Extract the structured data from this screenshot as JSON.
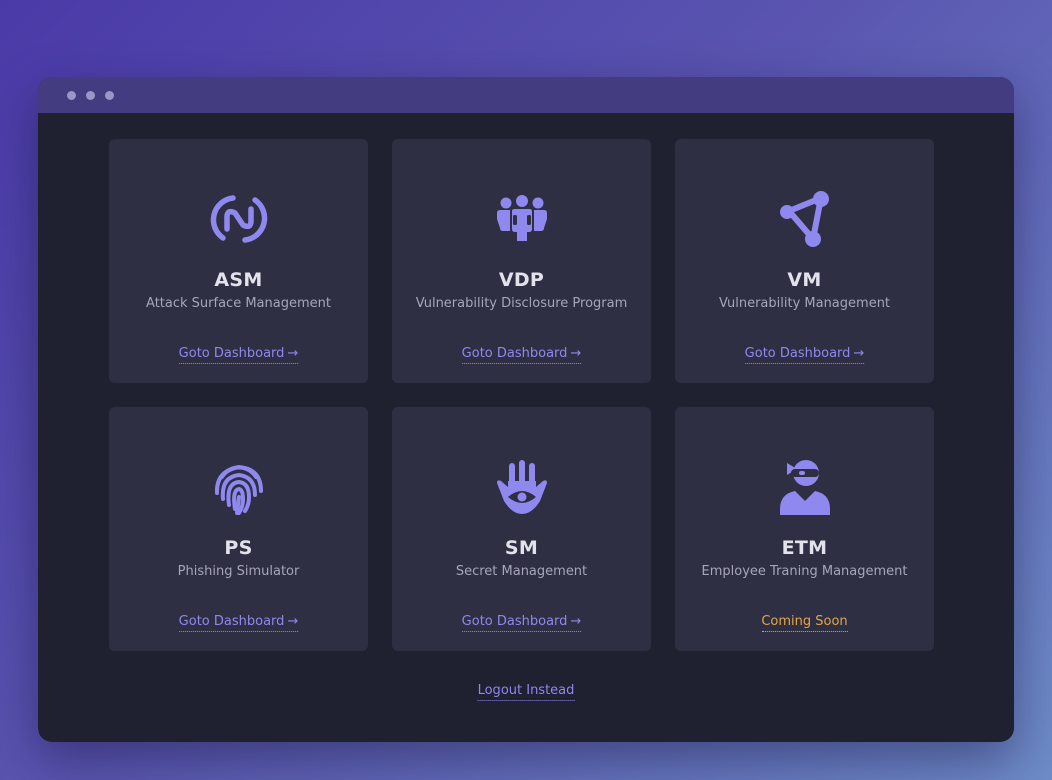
{
  "accent_color": "#8f88ee",
  "soon_color": "#e3a54a",
  "cards": [
    {
      "code": "ASM",
      "name": "Attack Surface Management",
      "action": "Goto Dashboard",
      "arrow": "→",
      "icon": "nfc-link-icon"
    },
    {
      "code": "VDP",
      "name": "Vulnerability Disclosure Program",
      "action": "Goto Dashboard",
      "arrow": "→",
      "icon": "people-group-icon"
    },
    {
      "code": "VM",
      "name": "Vulnerability Management",
      "action": "Goto Dashboard",
      "arrow": "→",
      "icon": "triangle-nodes-icon"
    },
    {
      "code": "PS",
      "name": "Phishing Simulator",
      "action": "Goto Dashboard",
      "arrow": "→",
      "icon": "fingerprint-icon"
    },
    {
      "code": "SM",
      "name": "Secret Management",
      "action": "Goto Dashboard",
      "arrow": "→",
      "icon": "hamsa-eye-icon"
    },
    {
      "code": "ETM",
      "name": "Employee Traning Management",
      "action": "Coming Soon",
      "arrow": "",
      "icon": "user-ninja-icon"
    }
  ],
  "logout_label": "Logout Instead"
}
